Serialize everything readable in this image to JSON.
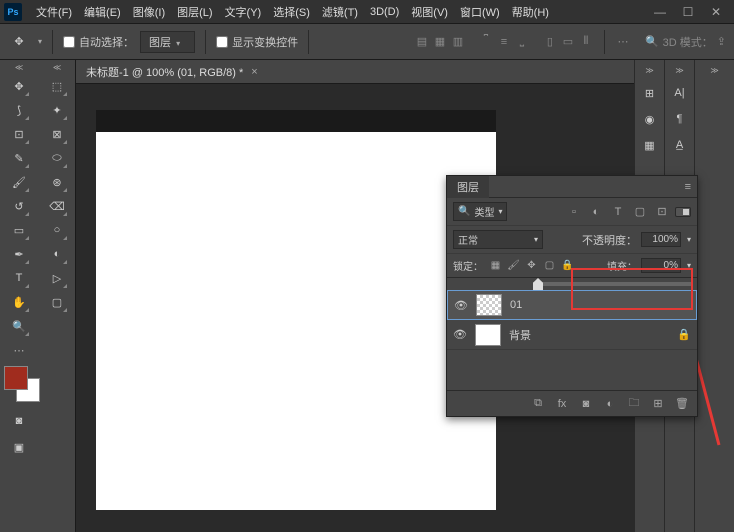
{
  "app": {
    "logo": "Ps"
  },
  "menu": [
    "文件(F)",
    "编辑(E)",
    "图像(I)",
    "图层(L)",
    "文字(Y)",
    "选择(S)",
    "滤镜(T)",
    "3D(D)",
    "视图(V)",
    "窗口(W)",
    "帮助(H)"
  ],
  "options": {
    "auto_select_label": "自动选择：",
    "auto_select_value": "图层",
    "show_transform_label": "显示变换控件",
    "three_d_label": "3D 模式："
  },
  "doc": {
    "tab_label": "未标题-1 @ 100% (01, RGB/8) *"
  },
  "layers_panel": {
    "title": "图层",
    "type_filter_label": "类型",
    "blend_mode": "正常",
    "opacity_label": "不透明度：",
    "opacity_value": "100%",
    "lock_label": "锁定：",
    "fill_label": "填充：",
    "fill_value": "0%",
    "layers": [
      {
        "name": "01",
        "visible": true,
        "locked": false,
        "selected": true
      },
      {
        "name": "背景",
        "visible": true,
        "locked": true,
        "selected": false
      }
    ]
  }
}
